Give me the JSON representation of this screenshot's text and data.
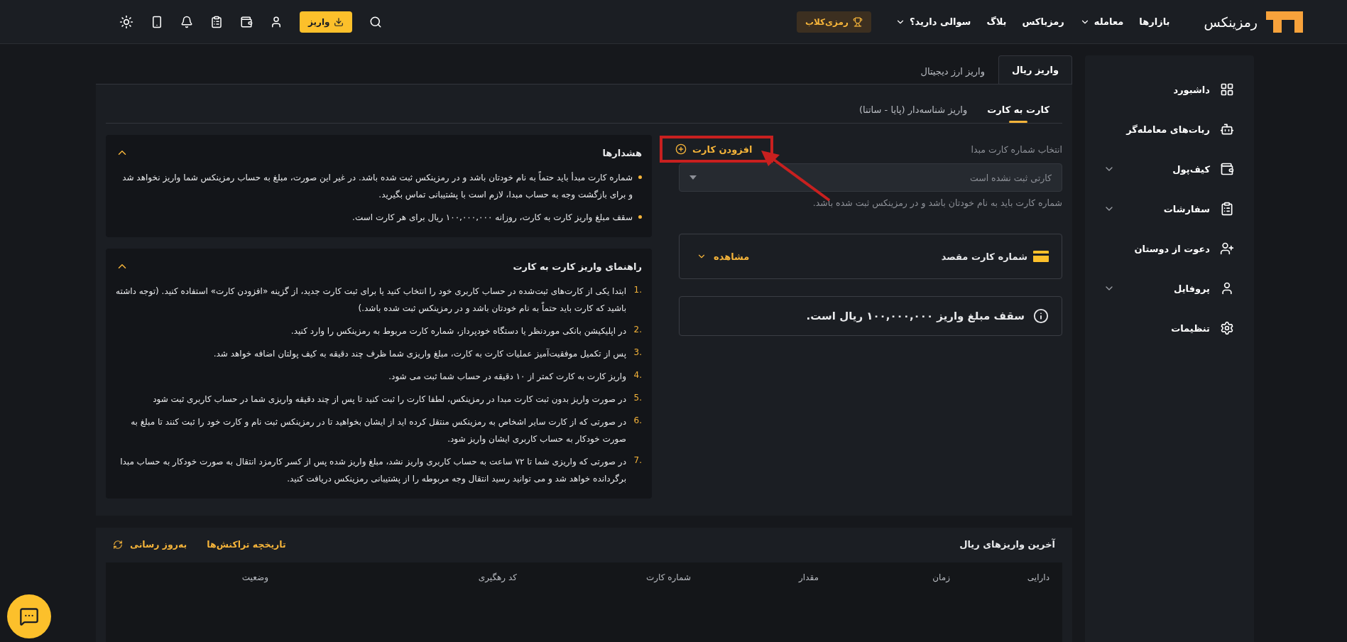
{
  "header": {
    "logo": "رمزینکس",
    "nav": [
      {
        "label": "بازارها",
        "dropdown": false
      },
      {
        "label": "معامله",
        "dropdown": true
      },
      {
        "label": "رمزباکس",
        "dropdown": false
      },
      {
        "label": "بلاگ",
        "dropdown": false
      },
      {
        "label": "سوالی دارید؟",
        "dropdown": true
      }
    ],
    "club_button": "رمزی‌کلاب",
    "deposit_button": "واریز"
  },
  "sidebar": {
    "items": [
      {
        "label": "داشبورد",
        "expandable": false
      },
      {
        "label": "ربات‌های معامله‌گر",
        "expandable": false
      },
      {
        "label": "کیف‌پول",
        "expandable": true
      },
      {
        "label": "سفارشات",
        "expandable": true
      },
      {
        "label": "دعوت از دوستان",
        "expandable": false
      },
      {
        "label": "پروفایل",
        "expandable": true
      },
      {
        "label": "تنظیمات",
        "expandable": false
      }
    ]
  },
  "tabs": [
    {
      "label": "واریز ریال",
      "selected": true
    },
    {
      "label": "واریز ارز دیجیتال",
      "selected": false
    }
  ],
  "subtabs": [
    {
      "label": "کارت به کارت",
      "selected": true
    },
    {
      "label": "واریز شناسه‌دار (پایا - ساتنا)",
      "selected": false
    }
  ],
  "form": {
    "label": "انتخاب شماره کارت مبدا",
    "add_card": "افزودن کارت",
    "select_placeholder": "کارتی ثبت نشده است",
    "hint": "شماره کارت باید به نام خودتان باشد و در رمزینکس ثبت شده باشد.",
    "destination": {
      "title": "شماره کارت مقصد",
      "toggle": "مشاهده",
      "expanded": false
    },
    "limit": "سقف مبلغ واریز ۱۰۰,۰۰۰,۰۰۰ ریال است."
  },
  "warnings": {
    "title": "هشدارها",
    "expanded": true,
    "items": [
      "شماره کارت مبدأ باید حتماً به نام خودتان باشد و در رمزینکس ثبت شده باشد. در غیر این صورت، مبلغ به حساب رمزینکس شما واریز نخواهد شد و برای بازگشت وجه به حساب مبدا، لازم است با پشتیبانی تماس بگیرید.",
      "سقف مبلغ واریز کارت به کارت، روزانه ۱۰۰,۰۰۰,۰۰۰ ریال برای هر کارت است."
    ]
  },
  "guide": {
    "title": "راهنمای واریز کارت به کارت",
    "expanded": true,
    "items": [
      {
        "number": "1.",
        "text": "ابتدا یکی از کارت‌های ثبت‌شده در حساب کاربری خود را انتخاب کنید یا برای ثبت کارت جدید، از گزینه «افزودن کارت» استفاده کنید. (توجه داشته باشید که کارت باید حتماً به نام خودتان باشد و در رمزینکس ثبت شده باشد.)"
      },
      {
        "number": "2.",
        "text": "در اپلیکیشن بانکی موردنظر یا دستگاه خودپرداز، شماره کارت مربوط به رمزینکس را وارد کنید."
      },
      {
        "number": "3.",
        "text": "پس از تکمیل موفقیت‌آمیز عملیات کارت به کارت، مبلغ واریزی شما ظرف چند دقیقه به کیف پولتان اضافه خواهد شد."
      },
      {
        "number": "4.",
        "text": "واریز کارت به کارت کمتر از ۱۰ دقیقه در حساب شما ثبت می شود."
      },
      {
        "number": "5.",
        "text": "در صورت واریز بدون ثبت کارت مبدا در رمزینکس، لطفا کارت را ثبت کنید تا پس از چند دقیقه واریزی شما در حساب کاربری ثبت شود"
      },
      {
        "number": "6.",
        "text": "در صورتی که از کارت سایر اشخاص به رمزینکس منتقل کرده اید از ایشان بخواهید تا در رمزینکس ثبت نام و کارت خود را ثبت کنند تا مبلغ به صورت خودکار به حساب کاربری ایشان واریز شود."
      },
      {
        "number": "7.",
        "text": "در صورتی که واریزی شما تا ۷۲ ساعت به حساب کاربری واریز نشد، مبلغ واریز شده پس از کسر کارمزد انتقال به صورت خودکار به حساب مبدا برگردانده خواهد شد و می توانید رسید انتقال وجه مربوطه را از پشتیبانی رمزینکس دریافت کنید."
      }
    ]
  },
  "history": {
    "title": "آخرین واریزهای ریال",
    "links": [
      "تاریخچه تراکنش‌ها",
      "به‌روز رسانی"
    ],
    "columns": [
      "دارایی",
      "زمان",
      "مقدار",
      "شماره کارت",
      "کد رهگیری",
      "وضعیت"
    ]
  }
}
